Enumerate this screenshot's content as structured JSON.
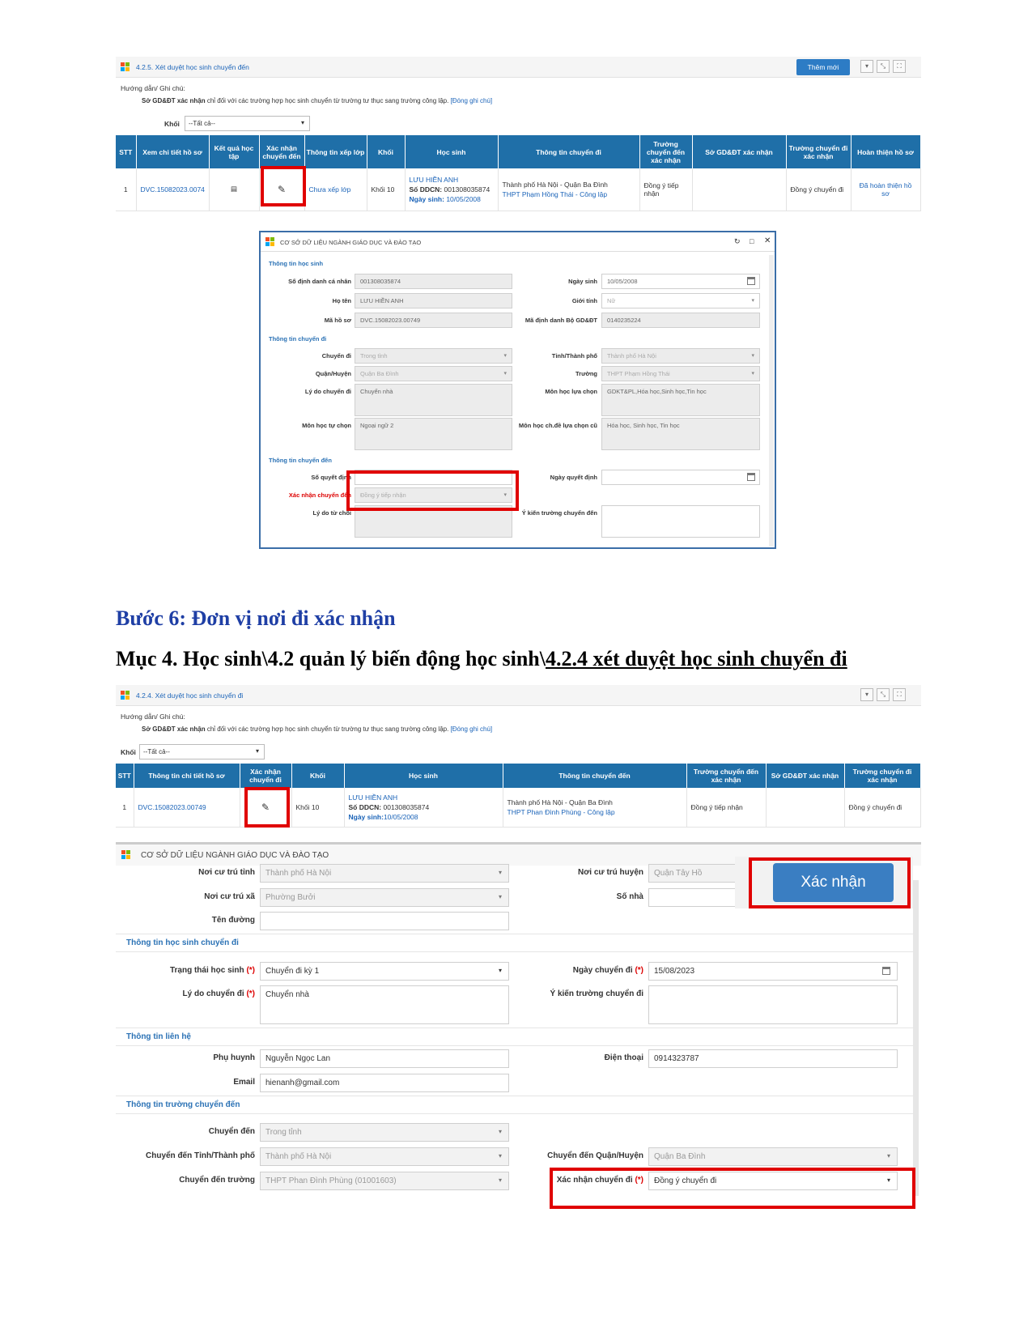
{
  "top_panel": {
    "title": "4.2.5. Xét duyệt học sinh chuyển đến",
    "add_button": "Thêm mới",
    "guide_label": "Hướng dẫn/ Ghi chú:",
    "guide_bold": "Sở GD&ĐT xác nhận",
    "guide_text": "chỉ đối với các trường hợp học sinh chuyển từ trường tư thục sang trường công lập.",
    "guide_close": "[Đóng ghi chú]",
    "filter_label": "Khối",
    "filter_value": "--Tất cả--",
    "headers": [
      "STT",
      "Xem chi tiết hồ sơ",
      "Kết quả học tập",
      "Xác nhận chuyển đến",
      "Thông tin xếp lớp",
      "Khối",
      "Học sinh",
      "Thông tin chuyển đi",
      "Trường chuyển đến xác nhận",
      "Sở GD&ĐT xác nhận",
      "Trường chuyển đi xác nhận",
      "Hoàn thiện hồ sơ"
    ],
    "row": {
      "stt": "1",
      "code": "DVC.15082023.0074",
      "class_info": "Chưa xếp lớp",
      "grade": "Khối 10",
      "student_name": "LƯU HIỀN ANH",
      "ddcn_label": "Số DDCN:",
      "ddcn_value": "001308035874",
      "dob_label": "Ngày sinh:",
      "dob_value": "10/05/2008",
      "from_line1": "Thành phố Hà Nội - Quận Ba Đình",
      "from_line2": "THPT Phạm Hồng Thái - Công lập",
      "dest_confirm": "Đồng ý tiếp nhận",
      "so_confirm": "",
      "src_confirm": "Đồng ý chuyển đi",
      "complete": "Đã hoàn thiện hồ sơ"
    }
  },
  "dialog1": {
    "title": "CƠ SỞ DỮ LIỆU NGÀNH GIÁO DỤC VÀ ĐÀO TẠO",
    "sec_student": "Thông tin học sinh",
    "sec_transfer_out": "Thông tin chuyển đi",
    "sec_transfer_in": "Thông tin chuyển đến",
    "labels": {
      "id": "Số định danh cá nhân",
      "dob": "Ngày sinh",
      "name": "Họ tên",
      "gender": "Giới tính",
      "file_code": "Mã hồ sơ",
      "moe_id": "Mã định danh Bộ GD&ĐT",
      "move_type": "Chuyển đi",
      "province": "Tỉnh/Thành phố",
      "district": "Quận/Huyện",
      "school": "Trường",
      "reason": "Lý do chuyển đi",
      "subjects": "Môn học lựa chọn",
      "self_subject": "Môn học tự chọn",
      "topic_subjects": "Môn học ch.đề lựa chọn cũ",
      "decision_no": "Số quyết định",
      "decision_date": "Ngày quyết định",
      "confirm_in": "Xác nhận chuyển đến",
      "refuse_reason": "Lý do từ chối",
      "school_opinion": "Ý kiến trường chuyển đến"
    },
    "values": {
      "id": "001308035874",
      "dob": "10/05/2008",
      "name": "LƯU HIỀN ANH",
      "gender": "Nữ",
      "file_code": "DVC.15082023.00749",
      "moe_id": "0140235224",
      "move_type": "Trong tỉnh",
      "province": "Thành phố Hà Nội",
      "district": "Quận Ba Đình",
      "school": "THPT Phạm Hồng Thái",
      "reason": "Chuyển nhà",
      "subjects": "GDKT&PL,Hóa học,Sinh học,Tin học",
      "self_subject": "Ngoại ngữ 2",
      "topic_subjects": "Hóa học, Sinh học, Tin học",
      "confirm_in": "Đồng ý tiếp nhận"
    }
  },
  "step_heading": "Bước 6:  Đơn vị nơi đi xác nhận",
  "muc_prefix": "Mục 4. Học sinh\\4.2 quản lý biến động học sinh\\",
  "muc_link": "4.2.4 xét duyệt học sinh chuyển đi",
  "bottom_panel": {
    "title": "4.2.4. Xét duyệt học sinh chuyển đi",
    "guide_label": "Hướng dẫn/ Ghi chú:",
    "guide_bold": "Sở GD&ĐT xác nhận",
    "guide_text": "chỉ đối với các trường hợp học sinh chuyển từ trường tư thục sang trường công lập.",
    "guide_close": "[Đóng ghi chú]",
    "filter_label": "Khối",
    "filter_value": "--Tất cả--",
    "headers": [
      "STT",
      "Thông tin chi tiết hồ sơ",
      "Xác nhận chuyển đi",
      "Khối",
      "Học sinh",
      "Thông tin chuyển đến",
      "Trường chuyển đến xác nhận",
      "Sở GD&ĐT xác nhận",
      "Trường chuyển đi xác nhận"
    ],
    "row": {
      "stt": "1",
      "code": "DVC.15082023.00749",
      "grade": "Khối 10",
      "student_name": "LƯU HIỀN ANH",
      "ddcn_label": "Số DDCN:",
      "ddcn_value": "001308035874",
      "dob_label": "Ngày sinh:",
      "dob_value": "10/05/2008",
      "to_line1": "Thành phố Hà Nội - Quận Ba Đình",
      "to_line2": "THPT Phan Đình Phùng - Công lập",
      "dest_confirm": "Đồng ý tiếp nhận",
      "so_confirm": "",
      "src_confirm": "Đồng ý chuyển đi"
    }
  },
  "dialog2": {
    "title": "CƠ SỞ DỮ LIỆU NGÀNH GIÁO DỤC VÀ ĐÀO TẠO",
    "confirm_button": "Xác nhận",
    "sec_out": "Thông tin học sinh chuyển đi",
    "sec_contact": "Thông tin liên hệ",
    "sec_dest": "Thông tin trường chuyển đến",
    "labels": {
      "province": "Nơi cư trú tỉnh",
      "district": "Nơi cư trú huyện",
      "ward": "Nơi cư trú xã",
      "house_no": "Số nhà",
      "street": "Tên đường",
      "status": "Trạng thái học sinh",
      "move_date": "Ngày chuyển đi",
      "reason": "Lý do chuyển đi",
      "school_opinion": "Ý kiến trường chuyển đi",
      "parent": "Phụ huynh",
      "phone": "Điện thoại",
      "email": "Email",
      "move_to": "Chuyển đến",
      "to_province": "Chuyển đến Tỉnh/Thành phố",
      "to_district": "Chuyển đến Quận/Huyện",
      "to_school": "Chuyển đến trường",
      "confirm_out": "Xác nhận chuyển đi"
    },
    "required_mark": "(*)",
    "values": {
      "province": "Thành phố Hà Nội",
      "district": "Quận Tây Hồ",
      "ward": "Phường Bưởi",
      "house_no": "",
      "street": "",
      "status": "Chuyển đi kỳ 1",
      "move_date": "15/08/2023",
      "reason": "Chuyển nhà",
      "parent": "Nguyễn Ngọc Lan",
      "phone": "0914323787",
      "email": "hienanh@gmail.com",
      "move_to": "Trong tỉnh",
      "to_province": "Thành phố Hà Nội",
      "to_district": "Quận Ba Đình",
      "to_school": "THPT Phan Đình Phùng (01001603)",
      "confirm_out": "Đồng ý chuyển đi"
    }
  },
  "colors": {
    "header_blue": "#1f6fa8",
    "highlight_red": "#e00000",
    "link_blue": "#1a63b8",
    "heading_blue": "#1f3fa5"
  },
  "icons": [
    "windows-logo-icon",
    "pencil-icon",
    "document-icon",
    "calendar-icon",
    "refresh-icon",
    "close-icon",
    "maximize-icon",
    "minimize-icon",
    "chevron-down-icon"
  ]
}
